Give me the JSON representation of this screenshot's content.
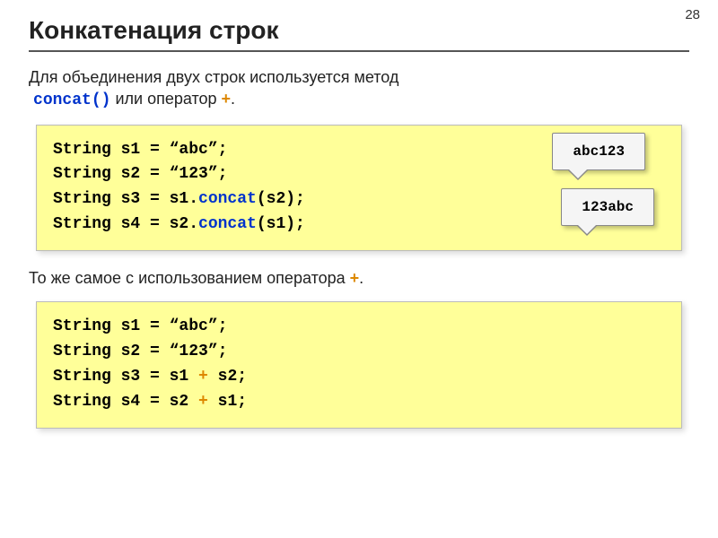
{
  "page_number": "28",
  "title": "Конкатенация строк",
  "intro_part1": "Для объединения двух строк используется метод ",
  "intro_concat": "concat()",
  "intro_part2": " или оператор ",
  "intro_plus": "+",
  "intro_part3": ".",
  "code1": {
    "line1_a": "String s1 = ",
    "line1_b": "“abc”",
    "line1_c": ";",
    "line2_a": "String s2 = ",
    "line2_b": "“123”",
    "line2_c": ";",
    "line3_a": "String s3 = s1.",
    "line3_b": "concat",
    "line3_c": "(s2);",
    "line4_a": "String s4 = s2.",
    "line4_b": "concat",
    "line4_c": "(s1);"
  },
  "callout1": "abc123",
  "callout2": "123abc",
  "middle_part1": "То же самое с использованием оператора ",
  "middle_plus": "+",
  "middle_part2": ".",
  "code2": {
    "line1_a": "String s1 = ",
    "line1_b": "“abc”",
    "line1_c": ";",
    "line2_a": "String s2 = ",
    "line2_b": "“123”",
    "line2_c": ";",
    "line3_a": "String s3 = s1 ",
    "line3_b": "+",
    "line3_c": " s2;",
    "line4_a": "String s4 = s2 ",
    "line4_b": "+",
    "line4_c": " s1;"
  }
}
